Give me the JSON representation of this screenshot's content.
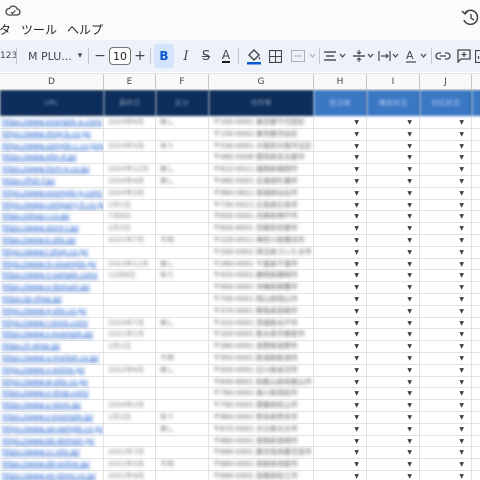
{
  "menu": [
    "タ",
    "ツール",
    "ヘルプ"
  ],
  "toolbar": {
    "format_label": "123",
    "font_name": "M PLU...",
    "font_size": "10",
    "minus": "−",
    "plus": "+",
    "bold": "B",
    "italic": "I",
    "strike": "S",
    "text_color": "A"
  },
  "columns": [
    "D",
    "E",
    "F",
    "G",
    "H",
    "I",
    "J"
  ],
  "header_row": [
    "URL",
    "最終日",
    "区分",
    "住所等",
    "担当者",
    "確認状況",
    "対応状況"
  ],
  "rows": [
    {
      "d": "https://www.example-a.com/",
      "e": "2024年6月",
      "f": "無し",
      "g": "〒100-0001 東京都千代田区"
    },
    {
      "d": "https://www.shop-b.co.jp/",
      "e": "",
      "f": "",
      "g": "〒150-0002 東京都渋谷区"
    },
    {
      "d": "https://www.sample-c.co.jp/page",
      "e": "2024年5月",
      "f": "有り",
      "g": "〒530-0001 大阪府大阪市北区"
    },
    {
      "d": "https://www.site-d.jp/",
      "e": "",
      "f": "",
      "g": "〒460-0008 愛知県名古屋市"
    },
    {
      "d": "https://www.item-e.co.jp/",
      "e": "2024年12月",
      "f": "無し",
      "g": "〒812-0011 福岡県福岡市"
    },
    {
      "d": "https://fish-f.jp/",
      "e": "2024年4月",
      "f": "無し",
      "g": "〒060-0001 北海道札幌市"
    },
    {
      "d": "https://www.example-g.com/",
      "e": "2024年3月",
      "f": "",
      "g": "〒980-0811 宮城県仙台市"
    },
    {
      "d": "https://www.company-h.co.jp/jp/",
      "e": "2月1日",
      "f": "",
      "g": "〒730-0011 広島県広島市"
    },
    {
      "d": "https://shop-i.co.jp/",
      "e": "7月8日",
      "f": "",
      "g": "〒650-0001 兵庫県神戸市"
    },
    {
      "d": "https://www.store-j.jp/",
      "e": "2月3日",
      "f": "",
      "g": "〒600-8001 京都府京都市"
    },
    {
      "d": "https://www.k-site.jp/",
      "e": "2021年7月",
      "f": "不明",
      "g": "〒220-0011 神奈川県横浜市"
    },
    {
      "d": "https://www.l-shop.co.jp/",
      "e": "",
      "f": "",
      "g": "〒330-0001 埼玉県さいたま市"
    },
    {
      "d": "https://www.m-example.jp/",
      "e": "2023年11月",
      "f": "無し",
      "g": "〒260-0001 千葉県千葉市"
    },
    {
      "d": "https://www.n-sample.com/",
      "e": "12月8日",
      "f": "有り",
      "g": "〒420-0001 静岡県静岡市"
    },
    {
      "d": "https://www.o-domain.jp/",
      "e": "",
      "f": "",
      "g": "〒900-0001 沖縄県那覇市"
    },
    {
      "d": "https://p-shop.jp/",
      "e": "",
      "f": "",
      "g": "〒700-0001 岡山県岡山市"
    },
    {
      "d": "https://www.q-site.co.jp/",
      "e": "",
      "f": "",
      "g": "〒370-0001 群馬県高崎市"
    },
    {
      "d": "https://www.r-store.com/",
      "e": "2024年7月",
      "f": "無し",
      "g": "〒310-0001 茨城県水戸市"
    },
    {
      "d": "https://www.s-example.jp/",
      "e": "2021年1月",
      "f": "",
      "g": "〒320-0001 栃木県宇都宮市"
    },
    {
      "d": "https://t-shop.jp/",
      "e": "2月1日",
      "f": "",
      "g": "〒380-0001 長野県長野市"
    },
    {
      "d": "https://www.u-market.co.jp/",
      "e": "",
      "f": "不明",
      "g": "〒950-0001 新潟県新潟市"
    },
    {
      "d": "https://www.v-online.jp/",
      "e": "2022年6月",
      "f": "無し",
      "g": "〒920-0001 石川県金沢市"
    },
    {
      "d": "https://www.w-site.co.jp/",
      "e": "",
      "f": "",
      "g": "〒640-8001 和歌山県和歌山市"
    },
    {
      "d": "https://www.x-shop.com/",
      "e": "",
      "f": "",
      "g": "〒760-0001 香川県高松市"
    },
    {
      "d": "https://www.y-store.jp/",
      "e": "2024年2月",
      "f": "",
      "g": "〒790-0001 愛媛県松山市"
    },
    {
      "d": "https://www.z-example.jp/",
      "e": "1月2日",
      "f": "有り",
      "g": "〒860-0001 熊本県熊本市"
    },
    {
      "d": "https://www.aa-sample.co.jp/",
      "e": "",
      "f": "無し",
      "g": "〒870-0001 大分県大分市"
    },
    {
      "d": "https://www.bb-domain.jp/",
      "e": "",
      "f": "",
      "g": "〒880-0001 宮崎県宮崎市"
    },
    {
      "d": "https://www.cc-site.jp/",
      "e": "2021年7月",
      "f": "",
      "g": "〒890-0001 鹿児島県鹿児島市"
    },
    {
      "d": "https://www.dd-online.jp/",
      "e": "2021年5月",
      "f": "不明",
      "g": "〒680-0001 鳥取県鳥取市"
    },
    {
      "d": "https://www.ee-store.co.jp/",
      "e": "2021年9月",
      "f": "",
      "g": "〒690-0001 島根県松江市"
    },
    {
      "d": "https://www.ff-example.jp/",
      "e": "2021年3月",
      "f": "有り",
      "g": "〒750-0001 山口県下関市"
    }
  ],
  "colors": {
    "header_dark": "#0d2d5a",
    "header_light": "#3b78c4",
    "link": "#1155cc",
    "bold_active_bg": "#d3e3fd"
  }
}
